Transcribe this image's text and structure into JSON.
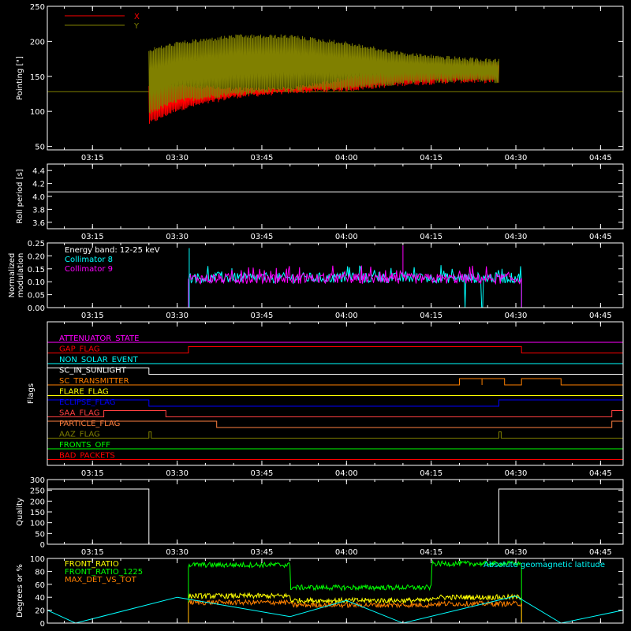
{
  "chart_data": [
    {
      "type": "line",
      "name": "pointing",
      "ylabel": "Pointing [\"]",
      "ylim": [
        45,
        250
      ],
      "yticks": [
        50,
        100,
        150,
        200,
        250
      ],
      "xlim": [
        "03:07",
        "04:49"
      ],
      "xticks": [
        "03:15",
        "03:30",
        "03:45",
        "04:00",
        "04:15",
        "04:30",
        "04:45"
      ],
      "legend": "top-left",
      "baseline": 128,
      "data_start": "03:25",
      "data_end": "04:27",
      "series": [
        {
          "name": "X",
          "color": "#ff0000",
          "x": [
            "03:25",
            "03:30",
            "03:40",
            "03:50",
            "04:00",
            "04:10",
            "04:20",
            "04:27"
          ],
          "lower": [
            80,
            100,
            118,
            125,
            128,
            136,
            140,
            140
          ],
          "upper": [
            140,
            140,
            135,
            135,
            150,
            165,
            170,
            172
          ]
        },
        {
          "name": "Y",
          "color": "#808000",
          "x": [
            "03:25",
            "03:30",
            "03:40",
            "03:50",
            "04:00",
            "04:10",
            "04:20",
            "04:27"
          ],
          "lower": [
            95,
            112,
            122,
            128,
            130,
            138,
            142,
            140
          ],
          "upper": [
            190,
            200,
            210,
            210,
            200,
            185,
            178,
            175
          ]
        }
      ]
    },
    {
      "type": "line",
      "name": "roll-period",
      "ylabel": "Roll period [s]",
      "ylim": [
        3.5,
        4.5
      ],
      "yticks": [
        3.6,
        3.8,
        4.0,
        4.2,
        4.4
      ],
      "xlim": [
        "03:07",
        "04:49"
      ],
      "xticks": [
        "03:15",
        "03:30",
        "03:45",
        "04:00",
        "04:15",
        "04:30",
        "04:45"
      ],
      "series": [
        {
          "name": "",
          "color": "#ffffff",
          "x": [
            "03:07",
            "04:49"
          ],
          "values": [
            4.07,
            4.07
          ]
        }
      ]
    },
    {
      "type": "line",
      "name": "modulation",
      "ylabel": "Normalized modulation",
      "ylim": [
        0,
        0.25
      ],
      "yticks": [
        0.0,
        0.05,
        0.1,
        0.15,
        0.2,
        0.25
      ],
      "xlim": [
        "03:07",
        "04:49"
      ],
      "xticks": [
        "03:15",
        "03:30",
        "03:45",
        "04:00",
        "04:15",
        "04:30",
        "04:45"
      ],
      "annotation": "Energy band: 12-25 keV",
      "data_start": "03:32",
      "data_end": "04:31",
      "series": [
        {
          "name": "Collimator 8",
          "color": "#00ffff",
          "center": 0.115,
          "spread": 0.02,
          "drops": [
            "04:21",
            "04:24"
          ]
        },
        {
          "name": "Collimator 9",
          "color": "#ff00ff",
          "center": 0.112,
          "spread": 0.02,
          "drops": []
        }
      ]
    },
    {
      "type": "line",
      "name": "flags",
      "ylabel": "Flags",
      "xlim": [
        "03:07",
        "04:49"
      ],
      "xticks": [
        "03:15",
        "03:30",
        "03:45",
        "04:00",
        "04:15",
        "04:30",
        "04:45"
      ],
      "flags": [
        {
          "label": "ATTENUATOR_STATE",
          "color": "#ff00ff",
          "steps": []
        },
        {
          "label": "GAP_FLAG",
          "color": "#ff0000",
          "steps": [
            [
              "03:32",
              "04:31"
            ]
          ]
        },
        {
          "label": "NON_SOLAR_EVENT",
          "color": "#00ffff",
          "steps": []
        },
        {
          "label": "SC_IN_SUNLIGHT",
          "color": "#ffffff",
          "steps": [
            [
              "03:07",
              "03:25"
            ]
          ],
          "invert": true
        },
        {
          "label": "SC_TRANSMITTER",
          "color": "#ff8000",
          "steps": [
            [
              "04:20",
              "04:24"
            ],
            [
              "04:24",
              "04:28"
            ],
            [
              "04:31",
              "04:38"
            ]
          ],
          "invert": true
        },
        {
          "label": "FLARE_FLAG",
          "color": "#ffff00",
          "steps": []
        },
        {
          "label": "ECLIPSE_FLAG",
          "color": "#0000ff",
          "steps": [
            [
              "03:07",
              "03:25"
            ],
            [
              "04:27",
              "04:49"
            ]
          ]
        },
        {
          "label": "SAA_FLAG",
          "color": "#ff4040",
          "steps": [
            [
              "03:17",
              "03:28"
            ],
            [
              "04:47",
              "04:49"
            ]
          ]
        },
        {
          "label": "PARTICLE_FLAG",
          "color": "#ff8040",
          "steps": [
            [
              "03:07",
              "03:37"
            ],
            [
              "04:47",
              "04:49"
            ]
          ]
        },
        {
          "label": "AAZ_FLAG",
          "color": "#808000",
          "steps": [
            [
              "03:25",
              "03:25.4"
            ],
            [
              "04:27",
              "04:27.4"
            ]
          ]
        },
        {
          "label": "FRONTS_OFF",
          "color": "#00ff00",
          "steps": []
        },
        {
          "label": "BAD_PACKETS",
          "color": "#ff0000",
          "steps": []
        }
      ]
    },
    {
      "type": "line",
      "name": "quality",
      "ylabel": "Quality",
      "ylim": [
        0,
        300
      ],
      "yticks": [
        0,
        50,
        100,
        150,
        200,
        250,
        300
      ],
      "xlim": [
        "03:07",
        "04:49"
      ],
      "xticks": [
        "03:15",
        "03:30",
        "03:45",
        "04:00",
        "04:15",
        "04:30",
        "04:45"
      ],
      "series": [
        {
          "name": "",
          "color": "#ffffff",
          "x": [
            "03:07",
            "03:25",
            "03:25",
            "04:27",
            "04:27",
            "04:49"
          ],
          "values": [
            256,
            256,
            0,
            0,
            256,
            256
          ]
        }
      ]
    },
    {
      "type": "line",
      "name": "ratios",
      "ylabel": "Degrees or %",
      "ylim": [
        0,
        100
      ],
      "yticks": [
        0,
        20,
        40,
        60,
        80,
        100
      ],
      "xlim": [
        "03:07",
        "04:49"
      ],
      "data_start": "03:32",
      "data_end": "04:31",
      "series": [
        {
          "name": "FRONT_RATIO",
          "color": "#ffff00",
          "segments": [
            [
              "03:32",
              "03:50",
              42
            ],
            [
              "03:50",
              "04:15",
              35
            ],
            [
              "04:15",
              "04:31",
              40
            ]
          ]
        },
        {
          "name": "FRONT_RATIO_1225",
          "color": "#00ff00",
          "segments": [
            [
              "03:32",
              "03:50",
              90
            ],
            [
              "03:50",
              "04:15",
              55
            ],
            [
              "04:15",
              "04:31",
              92
            ]
          ]
        },
        {
          "name": "MAX_DET_VS_TOT",
          "color": "#ff8000",
          "segments": [
            [
              "03:32",
              "03:50",
              32
            ],
            [
              "03:50",
              "04:15",
              28
            ],
            [
              "04:15",
              "04:31",
              30
            ]
          ]
        },
        {
          "name": "Absolute geomagnetic latitude",
          "color": "#00ffff",
          "x": [
            "03:07",
            "03:12",
            "03:30",
            "03:50",
            "04:00",
            "04:10",
            "04:30",
            "04:38",
            "04:49"
          ],
          "values": [
            20,
            0,
            40,
            10,
            35,
            0,
            42,
            0,
            20
          ]
        }
      ]
    }
  ]
}
